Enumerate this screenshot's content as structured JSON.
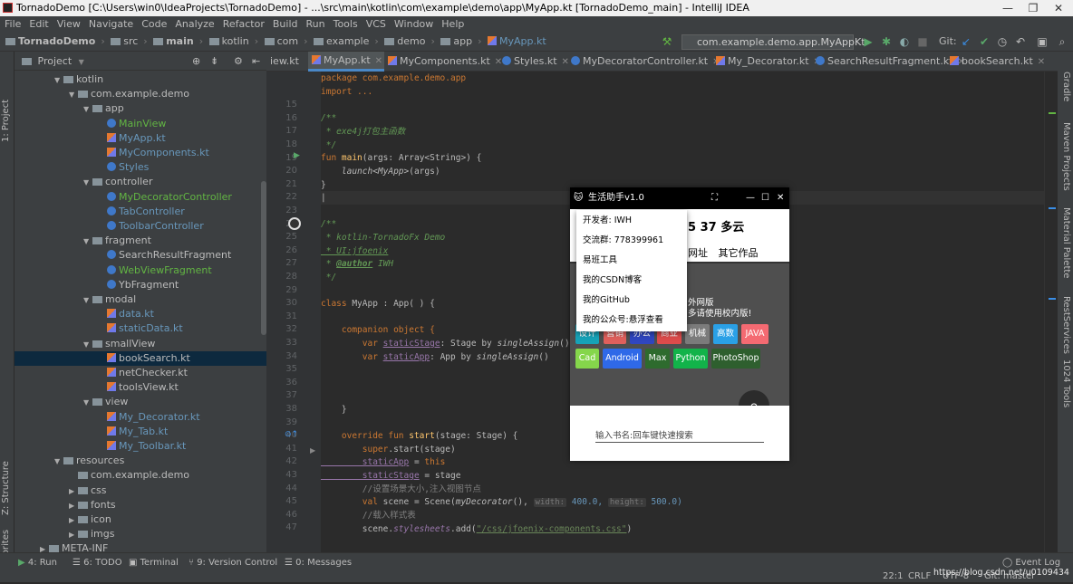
{
  "window": {
    "title": "TornadoDemo [C:\\Users\\win0\\IdeaProjects\\TornadoDemo] - ...\\src\\main\\kotlin\\com\\example\\demo\\app\\MyApp.kt [TornadoDemo_main] - IntelliJ IDEA",
    "minimize": "—",
    "maximize": "❐",
    "close": "✕"
  },
  "menu": [
    "File",
    "Edit",
    "View",
    "Navigate",
    "Code",
    "Analyze",
    "Refactor",
    "Build",
    "Run",
    "Tools",
    "VCS",
    "Window",
    "Help"
  ],
  "breadcrumbs": [
    "TornadoDemo",
    "src",
    "main",
    "kotlin",
    "com",
    "example",
    "demo",
    "app",
    "MyApp.kt"
  ],
  "toolbar": {
    "run_config": "com.example.demo.app.MyAppKt",
    "git_label": "Git:"
  },
  "project_panel": {
    "title": "Project",
    "tree": [
      {
        "label": "kotlin",
        "type": "folder",
        "arrow": "▼",
        "color": "w"
      },
      {
        "label": "com.example.demo",
        "type": "folder",
        "arrow": "▼",
        "color": "w"
      },
      {
        "label": "app",
        "type": "folder",
        "arrow": "▼",
        "color": "w"
      },
      {
        "label": "MainView",
        "type": "kt",
        "arrow": "",
        "color": "g"
      },
      {
        "label": "MyApp.kt",
        "type": "ktfile",
        "arrow": "",
        "color": "b"
      },
      {
        "label": "MyComponents.kt",
        "type": "ktfile",
        "arrow": "",
        "color": "b"
      },
      {
        "label": "Styles",
        "type": "kt",
        "arrow": "",
        "color": "b"
      },
      {
        "label": "controller",
        "type": "folder",
        "arrow": "▼",
        "color": "w"
      },
      {
        "label": "MyDecoratorController",
        "type": "kt",
        "arrow": "",
        "color": "g"
      },
      {
        "label": "TabController",
        "type": "kt",
        "arrow": "",
        "color": "b"
      },
      {
        "label": "ToolbarController",
        "type": "kt",
        "arrow": "",
        "color": "b"
      },
      {
        "label": "fragment",
        "type": "folder",
        "arrow": "▼",
        "color": "w"
      },
      {
        "label": "SearchResultFragment",
        "type": "kt",
        "arrow": "",
        "color": "w"
      },
      {
        "label": "WebViewFragment",
        "type": "kt",
        "arrow": "",
        "color": "g"
      },
      {
        "label": "YbFragment",
        "type": "kt",
        "arrow": "",
        "color": "w"
      },
      {
        "label": "modal",
        "type": "folder",
        "arrow": "▼",
        "color": "w"
      },
      {
        "label": "data.kt",
        "type": "ktfile",
        "arrow": "",
        "color": "b"
      },
      {
        "label": "staticData.kt",
        "type": "ktfile",
        "arrow": "",
        "color": "b"
      },
      {
        "label": "smallView",
        "type": "folder",
        "arrow": "▼",
        "color": "w"
      },
      {
        "label": "bookSearch.kt",
        "type": "ktfile",
        "arrow": "",
        "color": "w"
      },
      {
        "label": "netChecker.kt",
        "type": "ktfile",
        "arrow": "",
        "color": "w"
      },
      {
        "label": "toolsView.kt",
        "type": "ktfile",
        "arrow": "",
        "color": "w"
      },
      {
        "label": "view",
        "type": "folder",
        "arrow": "▼",
        "color": "w"
      },
      {
        "label": "My_Decorator.kt",
        "type": "ktfile",
        "arrow": "",
        "color": "b"
      },
      {
        "label": "My_Tab.kt",
        "type": "ktfile",
        "arrow": "",
        "color": "b"
      },
      {
        "label": "My_Toolbar.kt",
        "type": "ktfile",
        "arrow": "",
        "color": "b"
      },
      {
        "label": "resources",
        "type": "folder",
        "arrow": "▼",
        "color": "w"
      },
      {
        "label": "com.example.demo",
        "type": "folder",
        "arrow": "",
        "color": "w"
      },
      {
        "label": "css",
        "type": "folder",
        "arrow": "▶",
        "color": "w"
      },
      {
        "label": "fonts",
        "type": "folder",
        "arrow": "▶",
        "color": "w"
      },
      {
        "label": "icon",
        "type": "folder",
        "arrow": "▶",
        "color": "w"
      },
      {
        "label": "imgs",
        "type": "folder",
        "arrow": "▶",
        "color": "w"
      },
      {
        "label": "META-INF",
        "type": "folder",
        "arrow": "▶",
        "color": "w"
      }
    ]
  },
  "tabs": [
    "iew.kt",
    "MyApp.kt",
    "MyComponents.kt",
    "Styles.kt",
    "MyDecoratorController.kt",
    "My_Decorator.kt",
    "SearchResultFragment.kt",
    "bookSearch.kt"
  ],
  "line_numbers": [
    "",
    "",
    "15",
    "16",
    "17",
    "18",
    "19",
    "20",
    "21",
    "22",
    "23",
    "24",
    "25",
    "26",
    "27",
    "28",
    "29",
    "30",
    "31",
    "32",
    "33",
    "34",
    "35",
    "36",
    "37",
    "38",
    "39",
    "40",
    "41",
    "42",
    "43",
    "44",
    "45",
    "46",
    "47"
  ],
  "code": {
    "l1": "package com.example.demo.app",
    "l2": "import ...",
    "l16": "/**",
    "l17": " * exe4j打包主函数",
    "l18": " */",
    "l19a": "fun ",
    "l19b": "main",
    "l19c": "(args: Array<String>) {",
    "l20a": "    launch<MyApp>",
    "l20b": "(args)",
    "l21": "}",
    "l24": "/**",
    "l25": " * kotlin-TornadoFx Demo",
    "l26": " * UI:jfoenix",
    "l27a": " * ",
    "l27b": "@author",
    "l27c": " IWH",
    "l28": " */",
    "l29a": "class ",
    "l29b": "MyApp : App( ) {",
    "l31a": "    companion object {",
    "l32a": "        var ",
    "l32b": "staticStage",
    "l32c": ": Stage by ",
    "l32d": "singleAssign",
    "l32e": "()",
    "l33a": "        var ",
    "l33b": "staticApp",
    "l33c": ": App by ",
    "l33d": "singleAssign",
    "l33e": "()",
    "l38": "    }",
    "l40a": "    override fun ",
    "l40b": "start",
    "l40c": "(stage: Stage) {",
    "l41a": "        super",
    "l41b": ".start(stage)",
    "l42a": "        staticApp",
    "l42b": " = ",
    "l42c": "this",
    "l43a": "        staticStage",
    "l43b": " = stage",
    "l44": "        //设置场景大小,注入视图节点",
    "l45a": "        val ",
    "l45b": "scene = Scene(",
    "l45c": "myDecorator",
    "l45d": "(),",
    "l45e": "width:",
    "l45f": " 400.0, ",
    "l45g": "height:",
    "l45h": " 500.0)",
    "l46": "        //载入样式表",
    "l47a": "        scene.",
    "l47b": "stylesheets",
    "l47c": ".add(",
    "l47d": "\"/css/jfoenix-components.css\"",
    "l47e": ")"
  },
  "fx_app": {
    "title": "生活助手v1.0",
    "weather": "5 37 多云",
    "nav": [
      "网址",
      "其它作品"
    ],
    "body_line1": "外网版",
    "body_line2": "多请使用校内版!",
    "chips_row1": [
      {
        "label": "设计",
        "color": "#16a3b8"
      },
      {
        "label": "营销",
        "color": "#e0605c"
      },
      {
        "label": "办公",
        "color": "#3046c0"
      },
      {
        "label": "商业",
        "color": "#dd4b4b"
      },
      {
        "label": "机械",
        "color": "#7b7b7b"
      },
      {
        "label": "高数",
        "color": "#2aa0e6"
      },
      {
        "label": "JAVA",
        "color": "#f46a72"
      }
    ],
    "chips_row2": [
      {
        "label": "Cad",
        "color": "#85d64b"
      },
      {
        "label": "Android",
        "color": "#2f69e8"
      },
      {
        "label": "Max",
        "color": "#2e6b2e"
      },
      {
        "label": "Python",
        "color": "#12b34a"
      },
      {
        "label": "PhotoShop",
        "color": "#2e5f2e"
      }
    ],
    "search_placeholder": "输入书名:回车键快速搜索",
    "menu": [
      "开发者: IWH",
      "交流群: 778399961",
      "易班工具",
      "我的CSDN博客",
      "我的GitHub",
      "我的公众号:悬浮查看"
    ]
  },
  "left_tool_tabs": [
    "1: Project",
    "Z: Structure",
    "2: Favorites"
  ],
  "right_tool_tabs": [
    "Gradle",
    "Maven Projects",
    "Material Palette",
    "RestServices",
    "1024 Tools"
  ],
  "bottom_tools": [
    "4: Run",
    "6: TODO",
    "Terminal",
    "9: Version Control",
    "0: Messages"
  ],
  "status": {
    "event_log": "Event Log",
    "position": "22:1",
    "line_sep": "CRLF",
    "encoding": "UTF-8",
    "git": "Git: master",
    "watermark": "https://blog.csdn.net/u010943414"
  }
}
